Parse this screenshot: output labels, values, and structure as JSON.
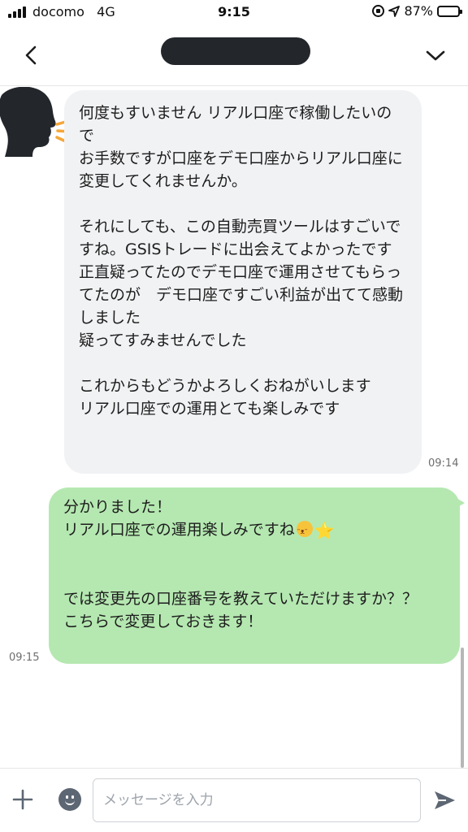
{
  "status_bar": {
    "carrier": "docomo",
    "network": "4G",
    "time": "9:15",
    "battery": "87%",
    "battery_fraction": 0.87
  },
  "header": {
    "back_icon": "chevron-left-icon",
    "menu_icon": "chevron-down-icon"
  },
  "messages": {
    "incoming": {
      "text": "何度もすいません リアル口座で稼働したいので\nお手数ですが口座をデモ口座からリアル口座に変更してくれませんか。\n\nそれにしても、この自動売買ツールはすごいですね。GSISトレードに出会えてよかったです\n正直疑ってたのでデモ口座で運用させてもらってたのが　デモ口座ですごい利益が出てて感動しました\n疑ってすみませんでした\n\nこれからもどうかよろしくおねがいします\nリアル口座での運用とても楽しみです",
      "time": "09:14"
    },
    "outgoing": {
      "line1": "分かりました！",
      "line2": "リアル口座での運用楽しみですね",
      "emoji_star": "⭐",
      "line3": "では変更先の口座番号を教えていただけますか？？",
      "line4": "こちらで変更しておきます！",
      "time": "09:15"
    }
  },
  "input_bar": {
    "placeholder": "メッセージを入力",
    "value": ""
  },
  "colors": {
    "incoming_bubble": "#f1f2f4",
    "outgoing_bubble": "#b5e8b1",
    "header_redaction": "#23272c"
  }
}
